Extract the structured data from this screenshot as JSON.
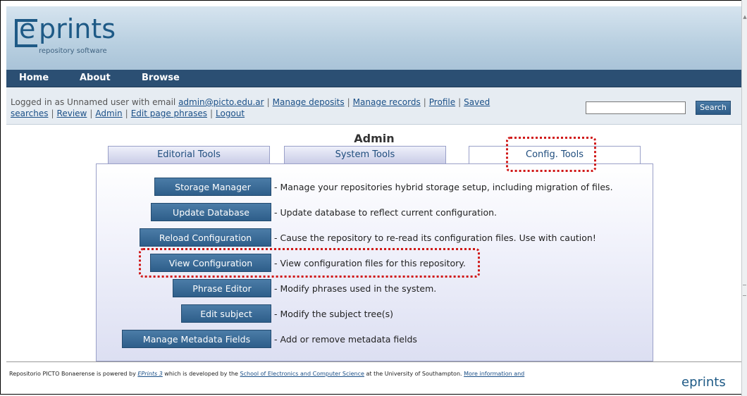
{
  "header": {
    "logo_e": "e",
    "logo_rest": "prints",
    "logo_tagline": "repository software"
  },
  "nav": {
    "items": [
      "Home",
      "About",
      "Browse"
    ]
  },
  "userbar": {
    "logged_prefix": "Logged in as Unnamed user with email ",
    "email": "admin@picto.edu.ar",
    "links_line1": [
      "Manage deposits",
      "Manage records",
      "Profile",
      "Saved"
    ],
    "links_line2": [
      "searches",
      "Review",
      "Admin",
      "Edit page phrases",
      "Logout"
    ],
    "search_value": "",
    "search_label": "Search"
  },
  "page_title": "Admin",
  "tabs": [
    {
      "label": "Editorial Tools",
      "active": false
    },
    {
      "label": "System Tools",
      "active": false
    },
    {
      "label": "Config. Tools",
      "active": true
    }
  ],
  "tools": [
    {
      "button": "Storage Manager",
      "desc": "- Manage your repositories hybrid storage setup, including migration of files."
    },
    {
      "button": "Update Database",
      "desc": "- Update database to reflect current configuration."
    },
    {
      "button": "Reload Configuration",
      "desc": "- Cause the repository to re-read its configuration files. Use with caution!"
    },
    {
      "button": "View Configuration",
      "desc": "- View configuration files for this repository."
    },
    {
      "button": "Phrase Editor",
      "desc": "- Modify phrases used in the system."
    },
    {
      "button": "Edit subject",
      "desc": "- Modify the subject tree(s)"
    },
    {
      "button": "Manage Metadata Fields",
      "desc": "- Add or remove metadata fields"
    }
  ],
  "footer": {
    "prefix": "Repositorio PICTO Bonaerense is powered by ",
    "eprints_link": "EPrints 3",
    "middle": " which is developed by the ",
    "school_link": "School of Electronics and Computer Science",
    "after": " at the University of Southampton. ",
    "more_link": "More information and",
    "logo_text": "eprints"
  },
  "colors": {
    "nav_bg": "#2b4f73",
    "button_bg": "#2e5e8a",
    "highlight": "#d01818",
    "link": "#1a4f87"
  }
}
